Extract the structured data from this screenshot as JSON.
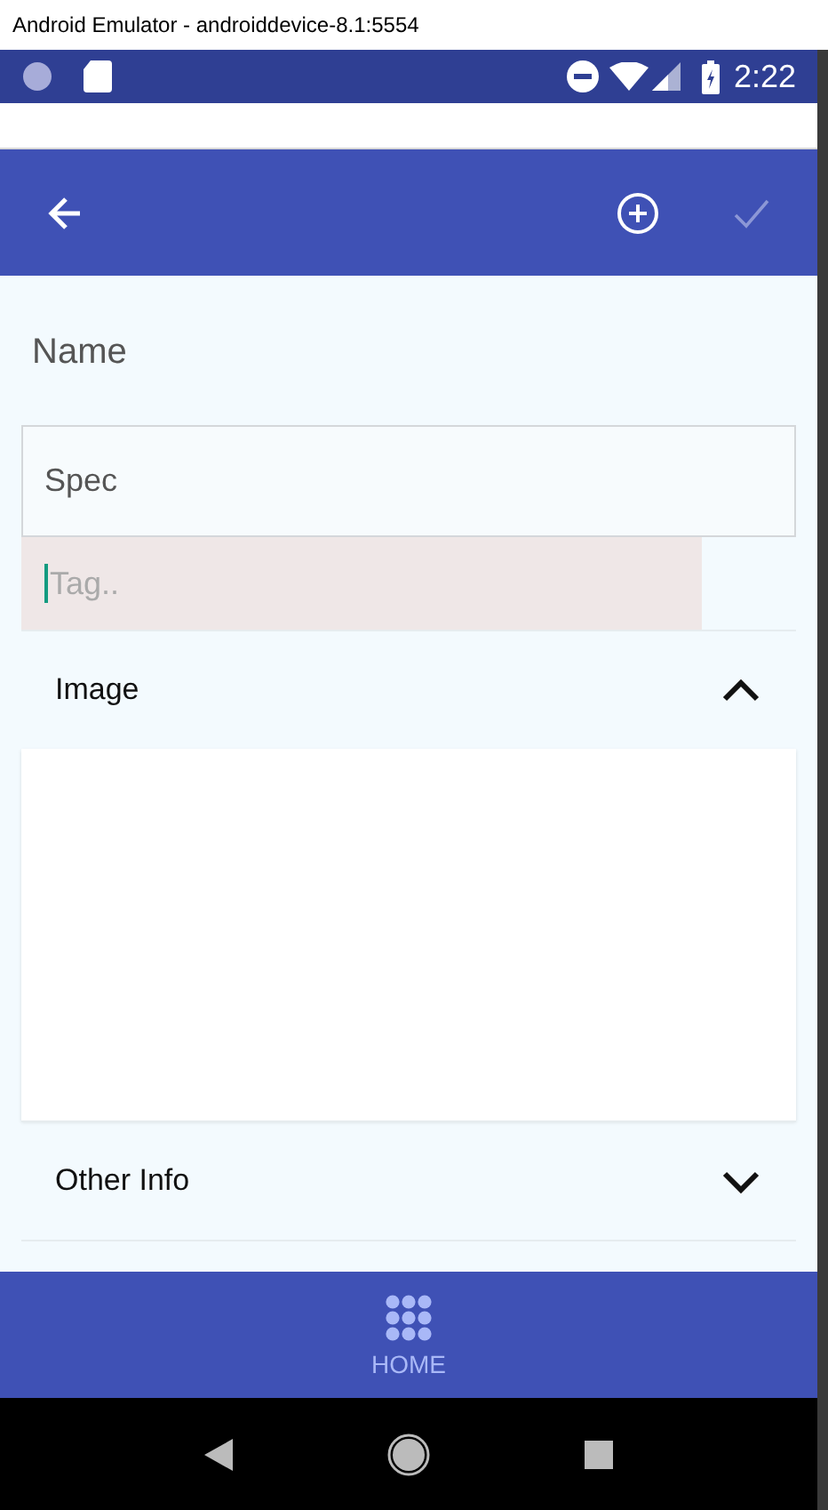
{
  "window": {
    "title": "Android Emulator - androiddevice-8.1:5554"
  },
  "status_bar": {
    "time": "2:22"
  },
  "app_bar": {
    "save_disabled": true
  },
  "form": {
    "label": "Name",
    "name_field": {
      "value": "Spec"
    },
    "tag_field": {
      "placeholder": "Tag..",
      "focused": true
    }
  },
  "sections": [
    {
      "title": "Image",
      "expanded": true
    },
    {
      "title": "Other Info",
      "expanded": false
    }
  ],
  "bottom_nav": [
    {
      "label": "HOME",
      "selected": true
    }
  ]
}
